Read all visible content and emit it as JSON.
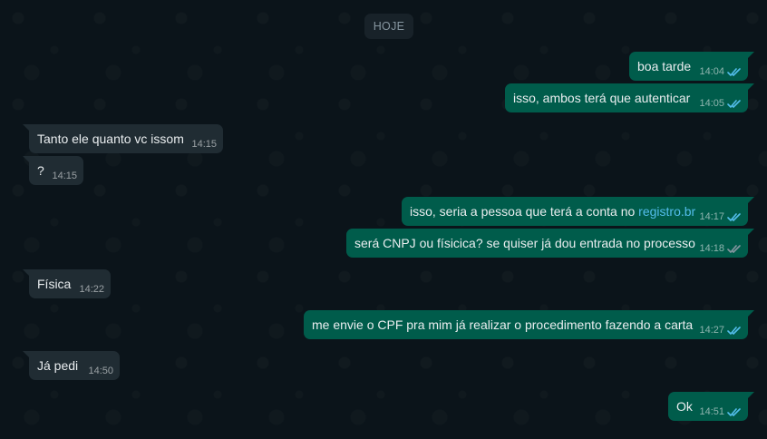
{
  "day_separator": "HOJE",
  "messages": [
    {
      "direction": "out",
      "text": "boa tarde",
      "time": "14:04",
      "status": "read"
    },
    {
      "direction": "out",
      "text": "isso, ambos terá que autenticar",
      "time": "14:05",
      "status": "read"
    },
    {
      "direction": "in",
      "text": "Tanto ele quanto vc issom",
      "time": "14:15"
    },
    {
      "direction": "in",
      "text": "?",
      "time": "14:15"
    },
    {
      "direction": "out",
      "text": "isso, seria a pessoa que terá a conta no ",
      "link": "registro.br",
      "time": "14:17",
      "status": "read"
    },
    {
      "direction": "out",
      "text": "será CNPJ ou físicica? se quiser já dou entrada no processo",
      "time": "14:18",
      "status": "delivered"
    },
    {
      "direction": "in",
      "text": "Física",
      "time": "14:22"
    },
    {
      "direction": "out",
      "text": "me envie o CPF  pra mim já realizar o procedimento fazendo a carta",
      "time": "14:27",
      "status": "read"
    },
    {
      "direction": "in",
      "text": "Já pedi",
      "time": "14:50"
    },
    {
      "direction": "out",
      "text": "Ok",
      "time": "14:51",
      "status": "read"
    }
  ],
  "colors": {
    "background": "#0b141a",
    "incoming_bubble": "#202c33",
    "outgoing_bubble": "#005c4b",
    "read_check": "#53bdeb",
    "delivered_check": "#8696a0",
    "link": "#53bdeb"
  },
  "icons": {
    "read": "double-check-icon",
    "delivered": "double-check-icon"
  }
}
